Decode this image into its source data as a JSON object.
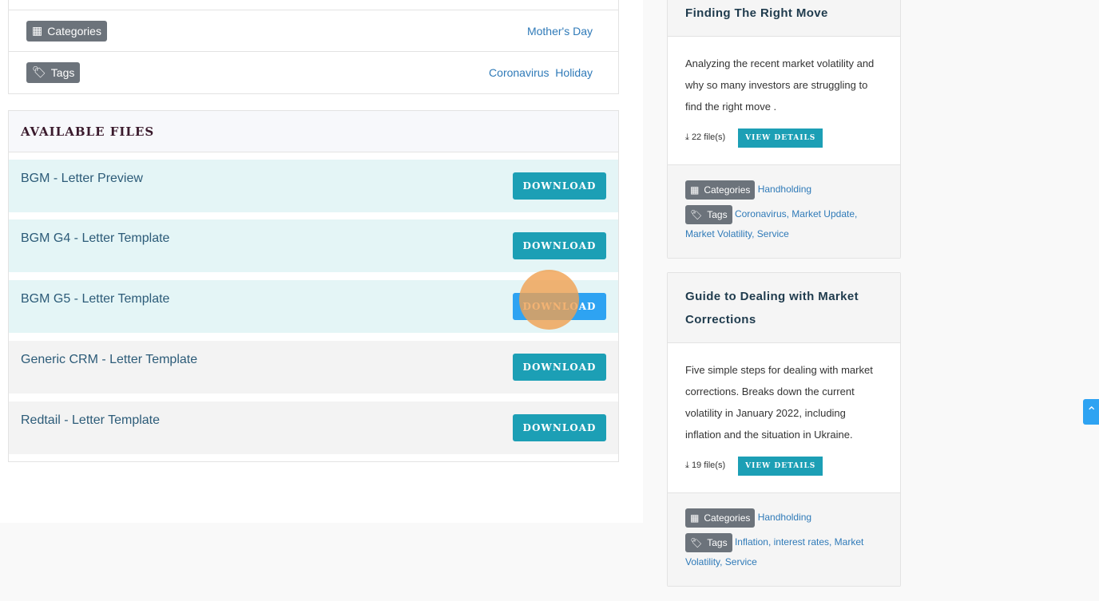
{
  "meta": {
    "categories_label": "Categories",
    "categories_value": "Mother's Day",
    "tags_label": "Tags",
    "tags_value": "Coronavirus  Holiday"
  },
  "files": {
    "title": "AVAILABLE FILES",
    "items": [
      {
        "name": "BGM - Letter Preview",
        "button": "DOWNLOAD"
      },
      {
        "name": "BGM G4 - Letter Template",
        "button": "DOWNLOAD"
      },
      {
        "name": "BGM G5 - Letter Template",
        "button": "DOWNLOAD"
      },
      {
        "name": "Generic CRM - Letter Template",
        "button": "DOWNLOAD"
      },
      {
        "name": "Redtail - Letter Template",
        "button": "DOWNLOAD"
      }
    ]
  },
  "cards": [
    {
      "title": "Finding The Right Move",
      "description": "Analyzing the recent market volatility and why so many investors are struggling to find the right move .",
      "files": "22 file(s)",
      "button": "VIEW DETAILS",
      "categories_label": "Categories",
      "categories": "Handholding",
      "tags_label": "Tags",
      "tags": "Coronavirus, Market Update, Market Volatility, Service"
    },
    {
      "title": "Guide to Dealing with Market Corrections",
      "description": "Five simple steps for dealing with market corrections.  Breaks down the current volatility in January 2022, including inflation and the situation in Ukraine.",
      "files": "19 file(s)",
      "button": "VIEW DETAILS",
      "categories_label": "Categories",
      "categories": "Handholding",
      "tags_label": "Tags",
      "tags": "Inflation, interest rates, Market Volatility, Service"
    }
  ],
  "colors": {
    "accent": "#1c9fb5",
    "hover": "#2ea3f2",
    "link": "#2f7ab8",
    "badge": "#6c737b"
  }
}
